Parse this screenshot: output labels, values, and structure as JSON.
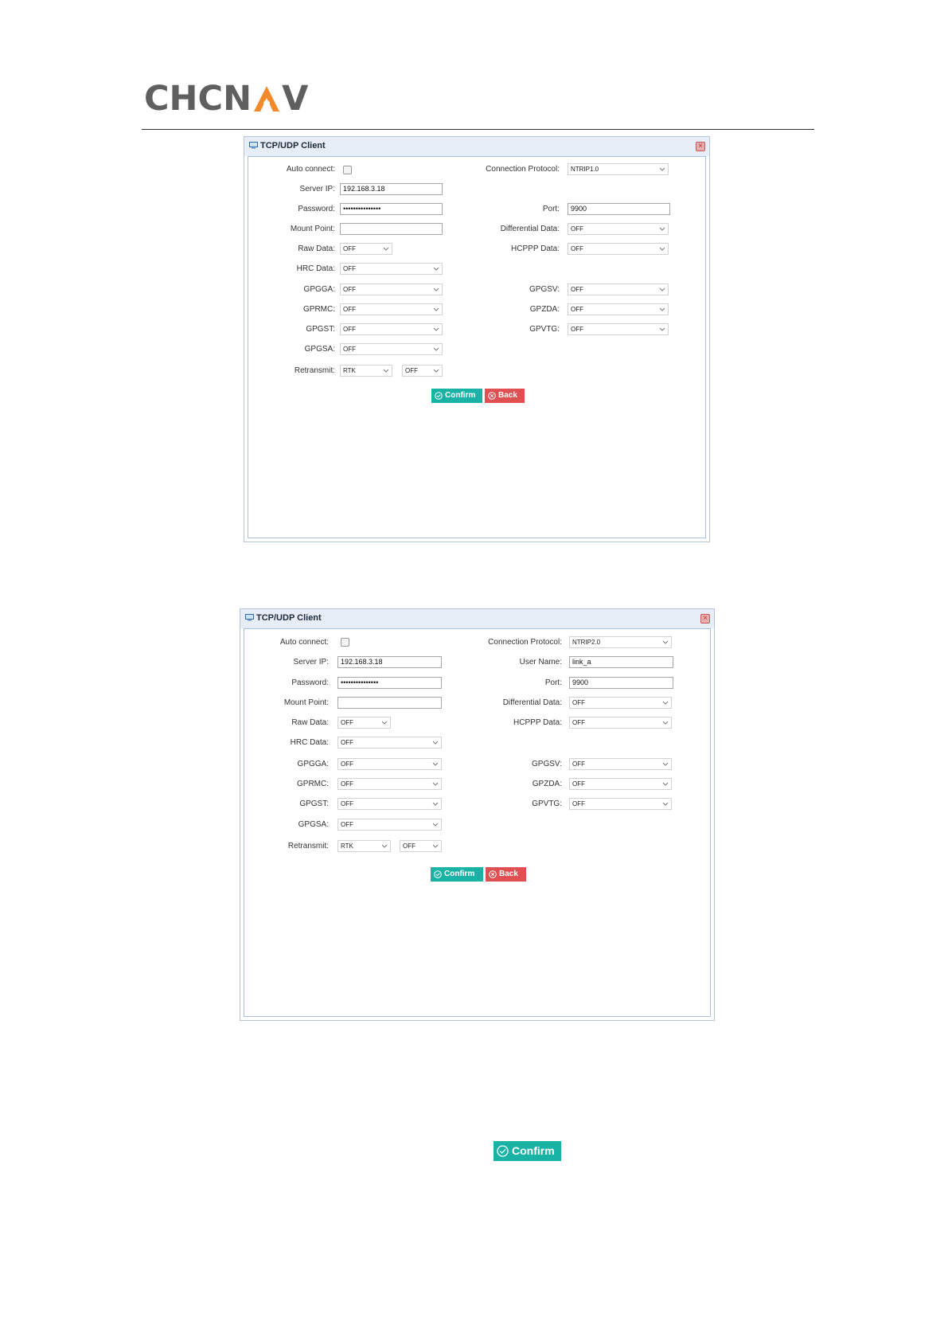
{
  "logo": {
    "left": "CHCN",
    "right": "V",
    "accent": "#f08a2a"
  },
  "dialog1": {
    "title": "TCP/UDP Client",
    "auto_connect_label": "Auto connect:",
    "server_ip_label": "Server IP:",
    "server_ip": "192.168.3.18",
    "password_label": "Password:",
    "password": "•••••••••••••••",
    "mount_point_label": "Mount Point:",
    "mount_point": "",
    "raw_data_label": "Raw Data:",
    "raw_data": "OFF",
    "hrc_data_label": "HRC Data:",
    "hrc_data": "OFF",
    "gpgga_label": "GPGGA:",
    "gpgga": "OFF",
    "gprmc_label": "GPRMC:",
    "gprmc": "OFF",
    "gpgst_label": "GPGST:",
    "gpgst": "OFF",
    "gpgsa_label": "GPGSA:",
    "gpgsa": "OFF",
    "retransmit_label": "Retransmit:",
    "retransmit_1": "RTK",
    "retransmit_2": "OFF",
    "protocol_label": "Connection Protocol:",
    "protocol": "NTRIP1.0",
    "port_label": "Port:",
    "port": "9900",
    "diff_label": "Differential Data:",
    "diff": "OFF",
    "hcppp_label": "HCPPP Data:",
    "hcppp": "OFF",
    "gpgsv_label": "GPGSV:",
    "gpgsv": "OFF",
    "gpzda_label": "GPZDA:",
    "gpzda": "OFF",
    "gpvtg_label": "GPVTG:",
    "gpvtg": "OFF",
    "confirm": "Confirm",
    "back": "Back"
  },
  "dialog2": {
    "title": "TCP/UDP Client",
    "auto_connect_label": "Auto connect:",
    "server_ip_label": "Server IP:",
    "server_ip": "192.168.3.18",
    "password_label": "Password:",
    "password": "•••••••••••••••",
    "mount_point_label": "Mount Point:",
    "mount_point": "",
    "raw_data_label": "Raw Data:",
    "raw_data": "OFF",
    "hrc_data_label": "HRC Data:",
    "hrc_data": "OFF",
    "gpgga_label": "GPGGA:",
    "gpgga": "OFF",
    "gprmc_label": "GPRMC:",
    "gprmc": "OFF",
    "gpgst_label": "GPGST:",
    "gpgst": "OFF",
    "gpgsa_label": "GPGSA:",
    "gpgsa": "OFF",
    "retransmit_label": "Retransmit:",
    "retransmit_1": "RTK",
    "retransmit_2": "OFF",
    "protocol_label": "Connection Protocol:",
    "protocol": "NTRIP2.0",
    "user_name_label": "User Name:",
    "user_name": "link_a",
    "port_label": "Port:",
    "port": "9900",
    "diff_label": "Differential Data:",
    "diff": "OFF",
    "hcppp_label": "HCPPP Data:",
    "hcppp": "OFF",
    "gpgsv_label": "GPGSV:",
    "gpgsv": "OFF",
    "gpzda_label": "GPZDA:",
    "gpzda": "OFF",
    "gpvtg_label": "GPVTG:",
    "gpvtg": "OFF",
    "confirm": "Confirm",
    "back": "Back"
  },
  "confirm_button": "Confirm"
}
